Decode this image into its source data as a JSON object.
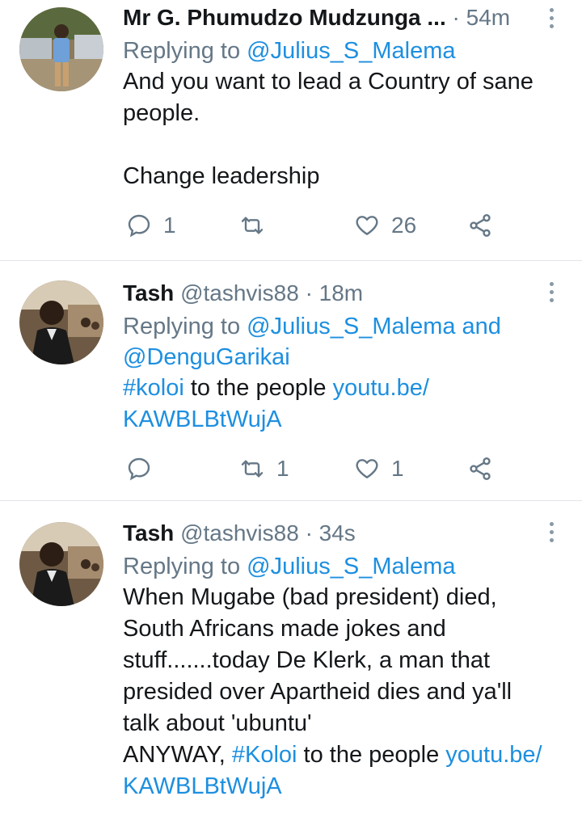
{
  "colors": {
    "link": "#1d8fe0",
    "muted": "#657786",
    "text": "#14171a",
    "divider": "#e1e4e8"
  },
  "tweets": [
    {
      "name": "Mr G. Phumudzo Mudzunga ...",
      "handle": "",
      "time": "· 54m",
      "replying_label": "Replying to",
      "replying_to": "@Julius_S_Malema",
      "replying_extra": "",
      "lines": [
        "And you want to lead a Country of sane",
        "people.",
        "",
        "Change leadership"
      ],
      "replies": "1",
      "retweets": "",
      "likes": "26"
    },
    {
      "name": "Tash",
      "handle": "@tashvis88",
      "time": "· 18m",
      "replying_label": "Replying to",
      "replying_to": "@Julius_S_Malema and",
      "replying_extra": "@DenguGarikai",
      "hashtag": "#koloi",
      "text_after": " to the people ",
      "link1": "youtu.be/",
      "link2": "KAWBLBtWujA",
      "replies": "",
      "retweets": "1",
      "likes": "1"
    },
    {
      "name": "Tash",
      "handle": "@tashvis88",
      "time": "· 34s",
      "replying_label": "Replying to",
      "replying_to": "@Julius_S_Malema",
      "lines": [
        "When Mugabe (bad president) died,",
        "South Africans made jokes and",
        "stuff.......today De Klerk, a man that",
        "presided over Apartheid dies and ya'll",
        "talk about 'ubuntu'"
      ],
      "last_prefix": "ANYWAY, ",
      "hashtag": "#Koloi",
      "text_after": " to the people ",
      "link1": "youtu.be/",
      "link2": "KAWBLBtWujA"
    }
  ]
}
